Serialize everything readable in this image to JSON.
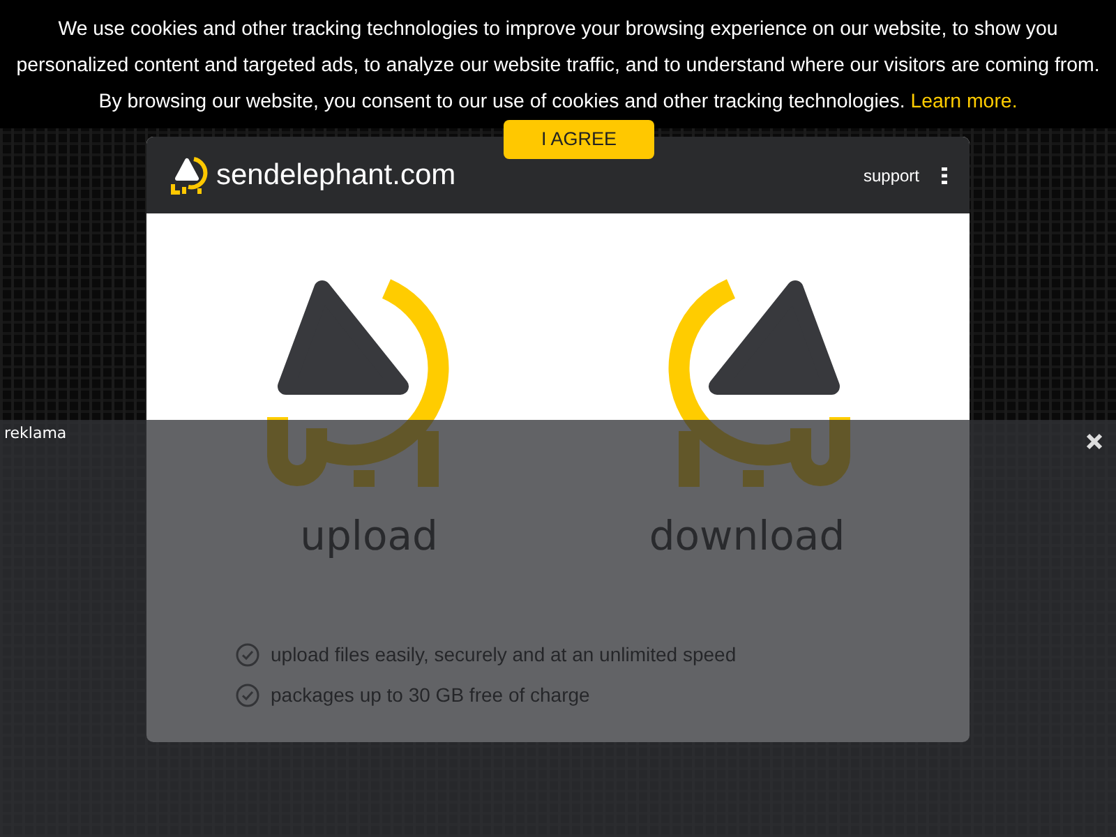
{
  "cookie_banner": {
    "text": "We use cookies and other tracking technologies to improve your browsing experience on our website, to show you personalized content and targeted ads, to analyze our website traffic, and to understand where our visitors are coming from. By browsing our website, you consent to our use of cookies and other tracking technologies.",
    "link": "Learn more.",
    "button": "I AGREE"
  },
  "header": {
    "logo_text": "sendelephant.com",
    "support_link": "support"
  },
  "actions": [
    {
      "kind": "upload",
      "label": "upload"
    },
    {
      "kind": "download",
      "label": "download"
    }
  ],
  "features": [
    "upload files easily, securely and at an unlimited speed",
    "packages up to 30 GB free of charge"
  ],
  "ad_overlay": {
    "label": "reklama"
  }
}
